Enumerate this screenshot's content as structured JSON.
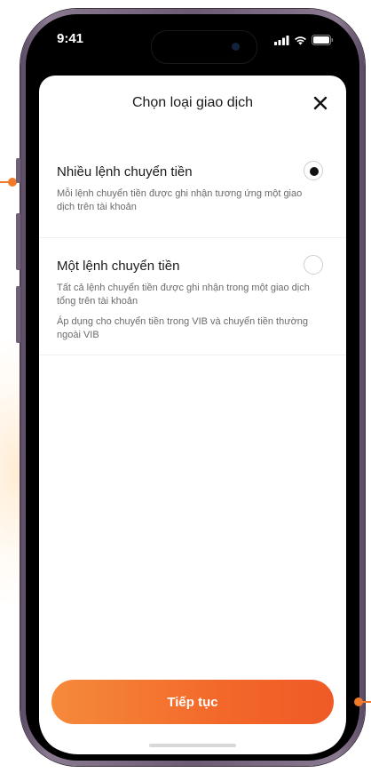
{
  "status_bar": {
    "time": "9:41"
  },
  "sheet": {
    "title": "Chọn loại giao dịch",
    "options": [
      {
        "title": "Nhiều lệnh chuyển tiền",
        "description": "Mỗi lệnh chuyển tiền được ghi nhận tương ứng một giao dịch trên tài khoản",
        "note": "",
        "selected": true
      },
      {
        "title": "Một lệnh chuyển tiền",
        "description": "Tất cả lệnh chuyển tiền được ghi nhận trong một giao dịch tổng trên tài khoản",
        "note": "Áp dụng cho chuyển tiền trong VIB và chuyển tiền thường ngoài VIB",
        "selected": false
      }
    ],
    "continue_label": "Tiếp tục"
  },
  "colors": {
    "accent": "#f3682a",
    "accent_start": "#f58a3b",
    "frame": "#6b5b73"
  },
  "icons": {
    "close": "close-icon",
    "signal": "cellular-signal-icon",
    "wifi": "wifi-icon",
    "battery": "battery-icon"
  }
}
